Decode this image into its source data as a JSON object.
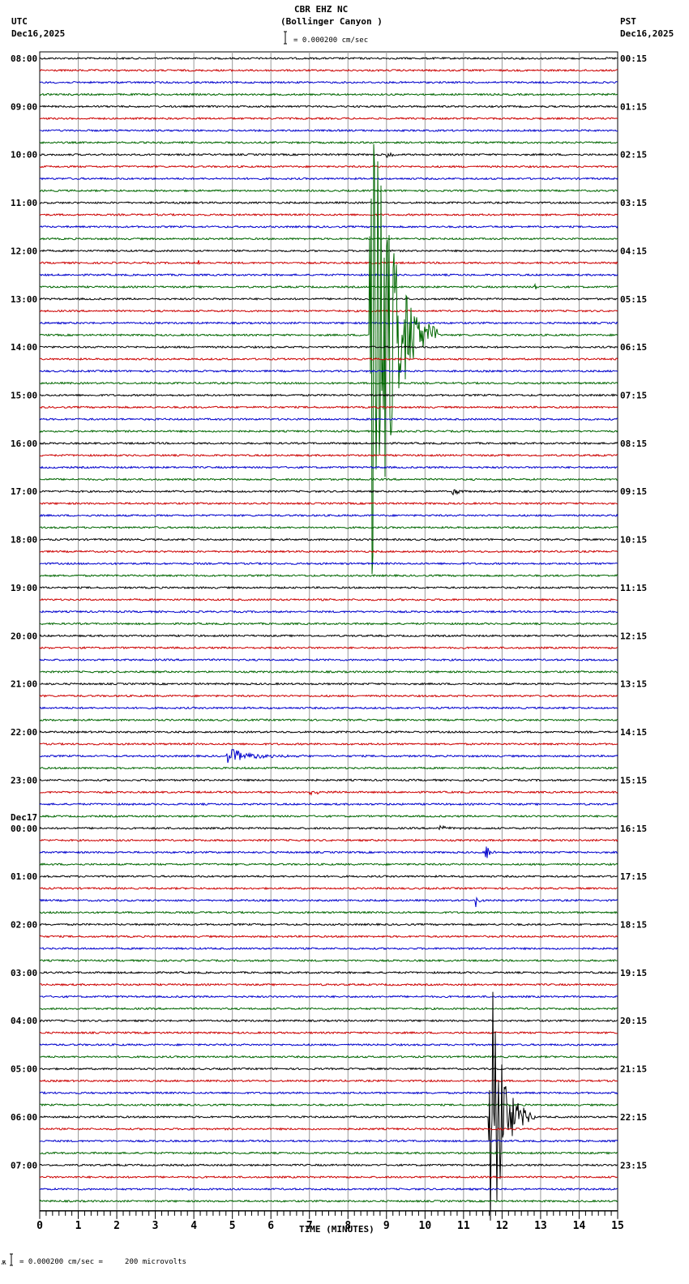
{
  "header": {
    "title": "CBR EHZ NC",
    "subtitle": "(Bollinger Canyon )",
    "scale_label": "= 0.000200 cm/sec",
    "left_tz": "UTC",
    "left_date": "Dec16,2025",
    "right_tz": "PST",
    "right_date": "Dec16,2025"
  },
  "footer": {
    "scale_note": "= 0.000200 cm/sec =     200 microvolts"
  },
  "chart_data": {
    "type": "line",
    "title": "CBR EHZ NC (Bollinger Canyon )",
    "xlabel": "TIME (MINUTES)",
    "xlim": [
      0,
      15
    ],
    "x_ticks": [
      "0",
      "1",
      "2",
      "3",
      "4",
      "5",
      "6",
      "7",
      "8",
      "9",
      "10",
      "11",
      "12",
      "13",
      "14",
      "15"
    ],
    "traces_per_hour": 4,
    "trace_colors": [
      "#000000",
      "#cc0000",
      "#0000cc",
      "#006600"
    ],
    "left_date_change": "Dec17",
    "left_labels": [
      "08:00",
      "09:00",
      "10:00",
      "11:00",
      "12:00",
      "13:00",
      "14:00",
      "15:00",
      "16:00",
      "17:00",
      "18:00",
      "19:00",
      "20:00",
      "21:00",
      "22:00",
      "23:00",
      "00:00",
      "01:00",
      "02:00",
      "03:00",
      "04:00",
      "05:00",
      "06:00",
      "07:00"
    ],
    "right_labels": [
      "00:15",
      "01:15",
      "02:15",
      "03:15",
      "04:15",
      "05:15",
      "06:15",
      "07:15",
      "08:15",
      "09:15",
      "10:15",
      "11:15",
      "12:15",
      "13:15",
      "14:15",
      "15:15",
      "16:15",
      "17:15",
      "18:15",
      "19:15",
      "20:15",
      "21:15",
      "22:15",
      "23:15"
    ],
    "events": [
      {
        "trace": 23,
        "minute": 8.55,
        "amplitude": 30,
        "duration": 1.8
      },
      {
        "trace": 88,
        "minute": 11.65,
        "amplitude": 15,
        "duration": 1.2
      },
      {
        "trace": 66,
        "minute": 11.55,
        "amplitude": 1.0,
        "duration": 0.4
      },
      {
        "trace": 70,
        "minute": 11.3,
        "amplitude": 0.8,
        "duration": 0.3
      },
      {
        "trace": 58,
        "minute": 4.85,
        "amplitude": 0.7,
        "duration": 2.5
      },
      {
        "trace": 8,
        "minute": 9.0,
        "amplitude": 0.3,
        "duration": 0.5
      },
      {
        "trace": 36,
        "minute": 10.7,
        "amplitude": 0.4,
        "duration": 0.5
      },
      {
        "trace": 64,
        "minute": 10.3,
        "amplitude": 0.3,
        "duration": 1.0
      },
      {
        "trace": 61,
        "minute": 7.0,
        "amplitude": 0.3,
        "duration": 1.0
      },
      {
        "trace": 19,
        "minute": 12.85,
        "amplitude": 0.6,
        "duration": 0.1
      },
      {
        "trace": 17,
        "minute": 4.1,
        "amplitude": 0.5,
        "duration": 0.1
      }
    ]
  }
}
